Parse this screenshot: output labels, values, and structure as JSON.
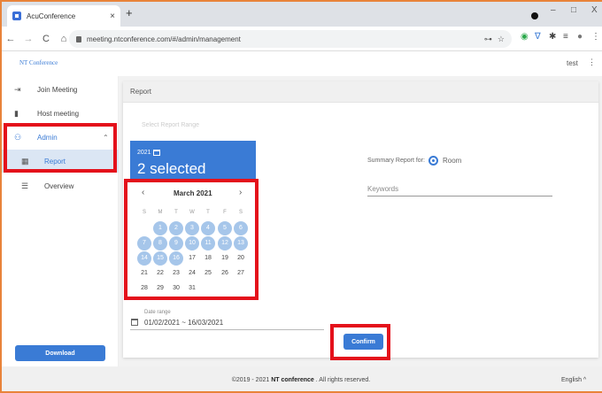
{
  "browser": {
    "tab_title": "AcuConference",
    "tab_close": "×",
    "new_tab": "+",
    "url": "meeting.ntconference.com/#/admin/management",
    "win_min": "–",
    "win_max": "□",
    "win_close": "X"
  },
  "app": {
    "brand": "NT Conference",
    "user": "test",
    "user_menu": "⋮"
  },
  "sidebar": {
    "items": [
      {
        "label": "Join Meeting",
        "icon": "login-icon"
      },
      {
        "label": "Host meeting",
        "icon": "phone-icon"
      },
      {
        "label": "Admin",
        "icon": "admin-users-icon",
        "expanded": true
      },
      {
        "label": "Report",
        "icon": "report-icon",
        "active": true
      },
      {
        "label": "Overview",
        "icon": "list-icon"
      }
    ],
    "download_label": "Download"
  },
  "main": {
    "title": "Report",
    "range_label": "Select Report Range",
    "picker": {
      "year": "2021",
      "selected_text": "2 selected",
      "month_label": "March 2021",
      "prev": "‹",
      "next": "›",
      "weekdays": [
        "S",
        "M",
        "T",
        "W",
        "T",
        "F",
        "S"
      ],
      "start_offset": 1,
      "days_in_month": 31,
      "selected_through": 16
    },
    "summary_label": "Summary Report for:",
    "room_label": "Room",
    "room_selected": true,
    "keywords_placeholder": "Keywords",
    "date_range_label": "Date range",
    "date_range_value": "01/02/2021 ~ 16/03/2021",
    "confirm_label": "Confirm"
  },
  "footer": {
    "copy_prefix": "©2019 - 2021 ",
    "copy_brand": "NT conference",
    "copy_suffix": " . All rights reserved.",
    "language": "English ^"
  },
  "colors": {
    "accent": "#3a7bd5",
    "selected_day": "#a6c6ea",
    "highlight": "#e4111b",
    "frame": "#e8833a"
  }
}
